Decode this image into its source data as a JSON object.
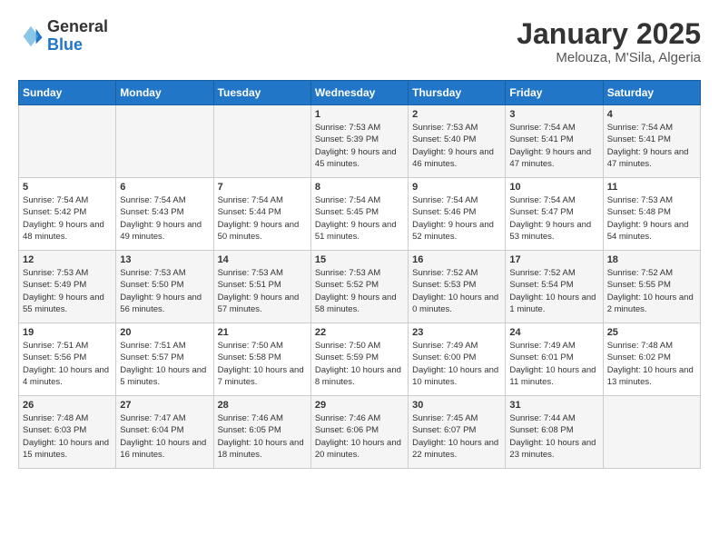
{
  "header": {
    "logo": {
      "general": "General",
      "blue": "Blue"
    },
    "month": "January 2025",
    "location": "Melouza, M'Sila, Algeria"
  },
  "weekdays": [
    "Sunday",
    "Monday",
    "Tuesday",
    "Wednesday",
    "Thursday",
    "Friday",
    "Saturday"
  ],
  "weeks": [
    [
      {
        "day": "",
        "detail": ""
      },
      {
        "day": "",
        "detail": ""
      },
      {
        "day": "",
        "detail": ""
      },
      {
        "day": "1",
        "detail": "Sunrise: 7:53 AM\nSunset: 5:39 PM\nDaylight: 9 hours\nand 45 minutes."
      },
      {
        "day": "2",
        "detail": "Sunrise: 7:53 AM\nSunset: 5:40 PM\nDaylight: 9 hours\nand 46 minutes."
      },
      {
        "day": "3",
        "detail": "Sunrise: 7:54 AM\nSunset: 5:41 PM\nDaylight: 9 hours\nand 47 minutes."
      },
      {
        "day": "4",
        "detail": "Sunrise: 7:54 AM\nSunset: 5:41 PM\nDaylight: 9 hours\nand 47 minutes."
      }
    ],
    [
      {
        "day": "5",
        "detail": "Sunrise: 7:54 AM\nSunset: 5:42 PM\nDaylight: 9 hours\nand 48 minutes."
      },
      {
        "day": "6",
        "detail": "Sunrise: 7:54 AM\nSunset: 5:43 PM\nDaylight: 9 hours\nand 49 minutes."
      },
      {
        "day": "7",
        "detail": "Sunrise: 7:54 AM\nSunset: 5:44 PM\nDaylight: 9 hours\nand 50 minutes."
      },
      {
        "day": "8",
        "detail": "Sunrise: 7:54 AM\nSunset: 5:45 PM\nDaylight: 9 hours\nand 51 minutes."
      },
      {
        "day": "9",
        "detail": "Sunrise: 7:54 AM\nSunset: 5:46 PM\nDaylight: 9 hours\nand 52 minutes."
      },
      {
        "day": "10",
        "detail": "Sunrise: 7:54 AM\nSunset: 5:47 PM\nDaylight: 9 hours\nand 53 minutes."
      },
      {
        "day": "11",
        "detail": "Sunrise: 7:53 AM\nSunset: 5:48 PM\nDaylight: 9 hours\nand 54 minutes."
      }
    ],
    [
      {
        "day": "12",
        "detail": "Sunrise: 7:53 AM\nSunset: 5:49 PM\nDaylight: 9 hours\nand 55 minutes."
      },
      {
        "day": "13",
        "detail": "Sunrise: 7:53 AM\nSunset: 5:50 PM\nDaylight: 9 hours\nand 56 minutes."
      },
      {
        "day": "14",
        "detail": "Sunrise: 7:53 AM\nSunset: 5:51 PM\nDaylight: 9 hours\nand 57 minutes."
      },
      {
        "day": "15",
        "detail": "Sunrise: 7:53 AM\nSunset: 5:52 PM\nDaylight: 9 hours\nand 58 minutes."
      },
      {
        "day": "16",
        "detail": "Sunrise: 7:52 AM\nSunset: 5:53 PM\nDaylight: 10 hours\nand 0 minutes."
      },
      {
        "day": "17",
        "detail": "Sunrise: 7:52 AM\nSunset: 5:54 PM\nDaylight: 10 hours\nand 1 minute."
      },
      {
        "day": "18",
        "detail": "Sunrise: 7:52 AM\nSunset: 5:55 PM\nDaylight: 10 hours\nand 2 minutes."
      }
    ],
    [
      {
        "day": "19",
        "detail": "Sunrise: 7:51 AM\nSunset: 5:56 PM\nDaylight: 10 hours\nand 4 minutes."
      },
      {
        "day": "20",
        "detail": "Sunrise: 7:51 AM\nSunset: 5:57 PM\nDaylight: 10 hours\nand 5 minutes."
      },
      {
        "day": "21",
        "detail": "Sunrise: 7:50 AM\nSunset: 5:58 PM\nDaylight: 10 hours\nand 7 minutes."
      },
      {
        "day": "22",
        "detail": "Sunrise: 7:50 AM\nSunset: 5:59 PM\nDaylight: 10 hours\nand 8 minutes."
      },
      {
        "day": "23",
        "detail": "Sunrise: 7:49 AM\nSunset: 6:00 PM\nDaylight: 10 hours\nand 10 minutes."
      },
      {
        "day": "24",
        "detail": "Sunrise: 7:49 AM\nSunset: 6:01 PM\nDaylight: 10 hours\nand 11 minutes."
      },
      {
        "day": "25",
        "detail": "Sunrise: 7:48 AM\nSunset: 6:02 PM\nDaylight: 10 hours\nand 13 minutes."
      }
    ],
    [
      {
        "day": "26",
        "detail": "Sunrise: 7:48 AM\nSunset: 6:03 PM\nDaylight: 10 hours\nand 15 minutes."
      },
      {
        "day": "27",
        "detail": "Sunrise: 7:47 AM\nSunset: 6:04 PM\nDaylight: 10 hours\nand 16 minutes."
      },
      {
        "day": "28",
        "detail": "Sunrise: 7:46 AM\nSunset: 6:05 PM\nDaylight: 10 hours\nand 18 minutes."
      },
      {
        "day": "29",
        "detail": "Sunrise: 7:46 AM\nSunset: 6:06 PM\nDaylight: 10 hours\nand 20 minutes."
      },
      {
        "day": "30",
        "detail": "Sunrise: 7:45 AM\nSunset: 6:07 PM\nDaylight: 10 hours\nand 22 minutes."
      },
      {
        "day": "31",
        "detail": "Sunrise: 7:44 AM\nSunset: 6:08 PM\nDaylight: 10 hours\nand 23 minutes."
      },
      {
        "day": "",
        "detail": ""
      }
    ]
  ]
}
